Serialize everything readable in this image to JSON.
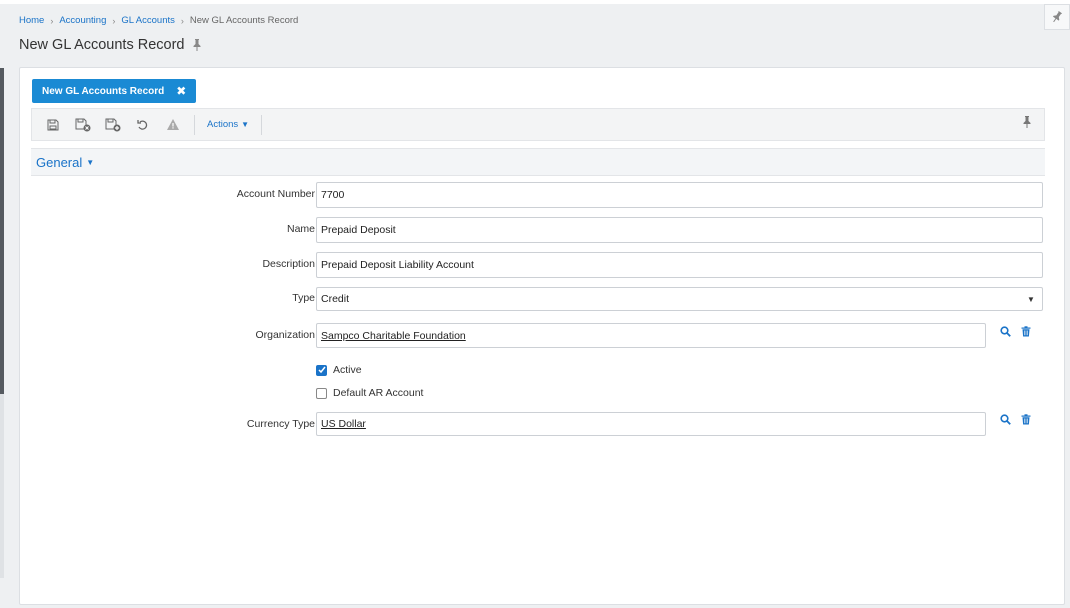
{
  "breadcrumb": {
    "items": [
      "Home",
      "Accounting",
      "GL Accounts"
    ],
    "current": "New GL Accounts Record"
  },
  "page": {
    "title": "New GL Accounts Record"
  },
  "tab": {
    "label": "New GL Accounts Record",
    "close": "✖"
  },
  "toolbar": {
    "actions_label": "Actions",
    "actions_caret": "▼"
  },
  "section": {
    "title": "General",
    "caret": "▼"
  },
  "form": {
    "account_number": {
      "label": "Account Number",
      "value": "7700"
    },
    "name": {
      "label": "Name",
      "value": "Prepaid Deposit"
    },
    "description": {
      "label": "Description",
      "value": "Prepaid Deposit Liability Account"
    },
    "type": {
      "label": "Type",
      "value": "Credit",
      "arrow": "▼"
    },
    "organization": {
      "label": "Organization",
      "value": "Sampco Charitable Foundation"
    },
    "active": {
      "label": "Active",
      "checked": true
    },
    "default_ar": {
      "label": "Default AR Account",
      "checked": false
    },
    "currency_type": {
      "label": "Currency Type",
      "value": "US Dollar"
    }
  },
  "colors": {
    "accent": "#1a8ad4",
    "link": "#1a73c8"
  }
}
